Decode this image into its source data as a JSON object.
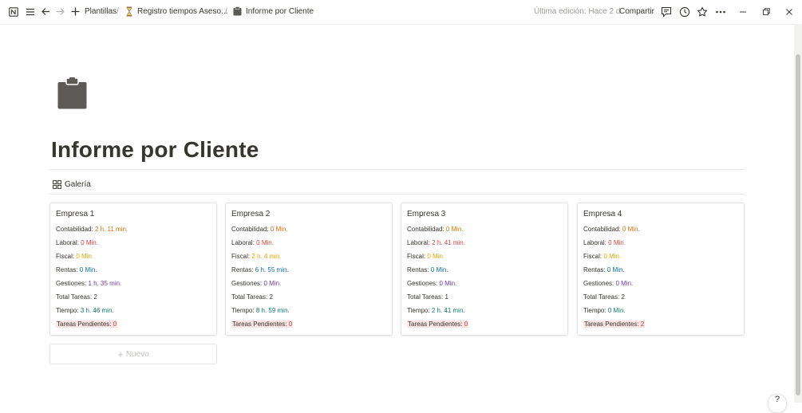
{
  "topbar": {
    "breadcrumbs": [
      {
        "label": "Plantillas"
      },
      {
        "label": "Registro tiempos Aseso..."
      },
      {
        "label": "Informe por Cliente"
      }
    ],
    "separator": "/",
    "last_edit": "Última edición: Hace 2 d",
    "share_label": "Compartir"
  },
  "page": {
    "title": "Informe por Cliente",
    "view_name": "Galería",
    "new_label": "Nuevo"
  },
  "colors": {
    "orange": "#d9730d",
    "red": "#e03e3e",
    "yellow": "#dfab01",
    "blue": "#0b6e99",
    "purple": "#6940a5",
    "green": "#0f7b6c"
  },
  "cards": [
    {
      "title": "Empresa 1",
      "props": [
        {
          "label": "Contabilidad: ",
          "value": "2 h. 11 min.",
          "color": "orange"
        },
        {
          "label": "Laboral: ",
          "value": "0 Min.",
          "color": "red"
        },
        {
          "label": "Fiscal: ",
          "value": "0 Min.",
          "color": "yellow"
        },
        {
          "label": "Rentas: ",
          "value": "0 Min.",
          "color": "blue"
        },
        {
          "label": "Gestiones: ",
          "value": "1 h. 35 min.",
          "color": "purple"
        },
        {
          "label": "Total Tareas: ",
          "value": "2",
          "color": "plain"
        },
        {
          "label": "Tiempo: ",
          "value": "3 h. 46 min.",
          "color": "green"
        },
        {
          "label": "Tareas Pendientes: ",
          "value": "0",
          "color": "pending"
        }
      ]
    },
    {
      "title": "Empresa 2",
      "props": [
        {
          "label": "Contabilidad: ",
          "value": "0 Min.",
          "color": "orange"
        },
        {
          "label": "Laboral: ",
          "value": "0 Min.",
          "color": "red"
        },
        {
          "label": "Fiscal: ",
          "value": "2 h. 4 min.",
          "color": "yellow"
        },
        {
          "label": "Rentas: ",
          "value": "6 h. 55 min.",
          "color": "blue"
        },
        {
          "label": "Gestiones: ",
          "value": "0 Min.",
          "color": "purple"
        },
        {
          "label": "Total Tareas: ",
          "value": "2",
          "color": "plain"
        },
        {
          "label": "Tiempo: ",
          "value": "8 h. 59 min.",
          "color": "green"
        },
        {
          "label": "Tareas Pendientes: ",
          "value": "0",
          "color": "pending"
        }
      ]
    },
    {
      "title": "Empresa 3",
      "props": [
        {
          "label": "Contabilidad: ",
          "value": "0 Min.",
          "color": "orange"
        },
        {
          "label": "Laboral: ",
          "value": "2 h. 41 min.",
          "color": "red"
        },
        {
          "label": "Fiscal: ",
          "value": "0 Min.",
          "color": "yellow"
        },
        {
          "label": "Rentas: ",
          "value": "0 Min.",
          "color": "blue"
        },
        {
          "label": "Gestiones: ",
          "value": "0 Min.",
          "color": "purple"
        },
        {
          "label": "Total Tareas: ",
          "value": "1",
          "color": "plain"
        },
        {
          "label": "Tiempo: ",
          "value": "2 h. 41 min.",
          "color": "green"
        },
        {
          "label": "Tareas Pendientes: ",
          "value": "0",
          "color": "pending"
        }
      ]
    },
    {
      "title": "Empresa 4",
      "props": [
        {
          "label": "Contabilidad: ",
          "value": "0 Min.",
          "color": "orange"
        },
        {
          "label": "Laboral: ",
          "value": "0 Min.",
          "color": "red"
        },
        {
          "label": "Fiscal: ",
          "value": "0 Min.",
          "color": "yellow"
        },
        {
          "label": "Rentas: ",
          "value": "0 Min.",
          "color": "blue"
        },
        {
          "label": "Gestiones: ",
          "value": "0 Min.",
          "color": "purple"
        },
        {
          "label": "Total Tareas: ",
          "value": "2",
          "color": "plain"
        },
        {
          "label": "Tiempo: ",
          "value": "0 Min.",
          "color": "green"
        },
        {
          "label": "Tareas Pendientes: ",
          "value": "2",
          "color": "pending"
        }
      ]
    }
  ]
}
